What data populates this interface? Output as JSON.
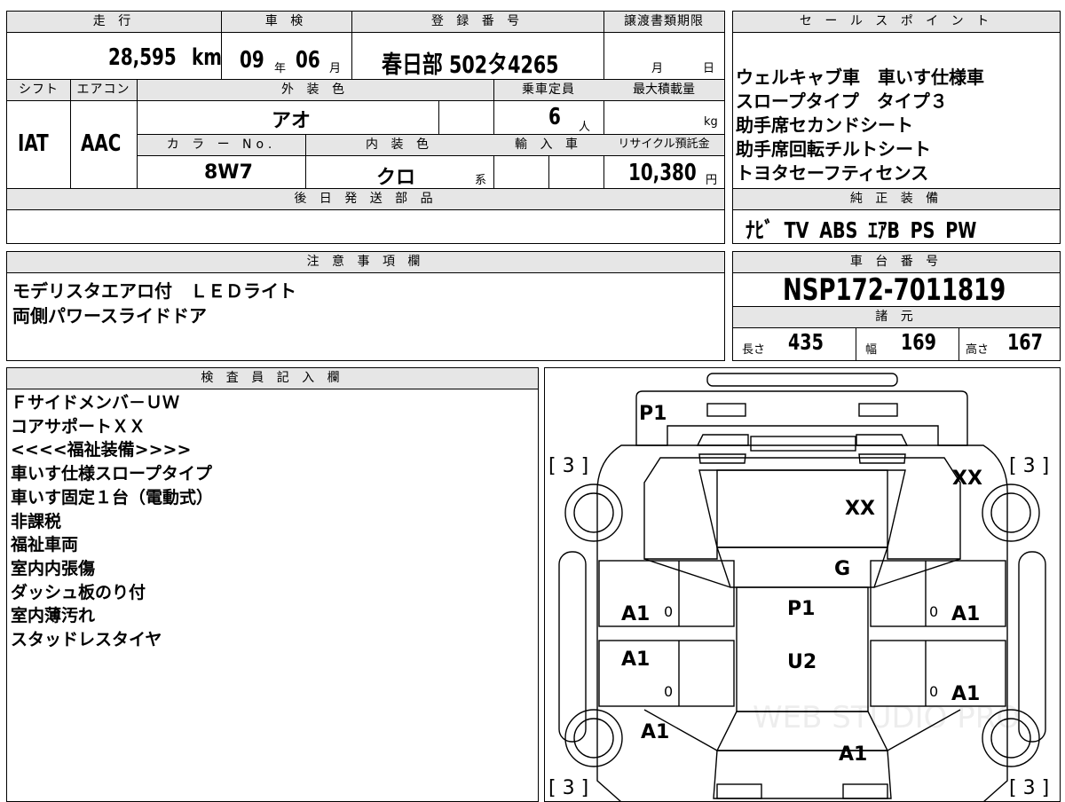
{
  "mileage": {
    "header": "走 行",
    "value": "28,595",
    "unit": "km"
  },
  "inspection": {
    "header": "車 検",
    "year": "09",
    "year_unit": "年",
    "month": "06",
    "month_unit": "月"
  },
  "registration": {
    "header": "登 録 番 号",
    "value": "春日部 502タ4265"
  },
  "transfer_deadline": {
    "header": "譲渡書類期限",
    "month_unit": "月",
    "day_unit": "日"
  },
  "sales_points": {
    "header": "セ ー ル ス ポ イ ン ト",
    "lines": [
      "ウェルキャブ車　車いす仕様車",
      "スロープタイプ　タイプ３",
      "助手席セカンドシート",
      "助手席回転チルトシート",
      "トヨタセーフティセンス"
    ]
  },
  "shift": {
    "header": "シフト",
    "value": "IAT"
  },
  "aircon": {
    "header": "エアコン",
    "value": "AAC"
  },
  "exterior_color": {
    "header": "外 装 色",
    "value": "アオ"
  },
  "capacity": {
    "header": "乗車定員",
    "value": "6",
    "unit": "人"
  },
  "max_load": {
    "header": "最大積載量",
    "unit": "kg"
  },
  "color_no": {
    "header": "カ ラ ー No.",
    "value": "8W7"
  },
  "interior_color": {
    "header": "内 装 色",
    "value": "クロ",
    "suffix": "系"
  },
  "import": {
    "header": "輸 入 車"
  },
  "recycle": {
    "header": "リサイクル預託金",
    "value": "10,380",
    "unit": "円"
  },
  "later_parts": {
    "header": "後 日 発 送 部 品"
  },
  "genuine_equipment": {
    "header": "純 正 装 備",
    "value": "ﾅﾋﾞ TV ABS ｴｱB PS PW"
  },
  "notes": {
    "header": "注 意 事 項 欄",
    "lines": [
      "モデリスタエアロ付　ＬＥＤライト",
      "両側パワースライドドア"
    ]
  },
  "chassis": {
    "header": "車 台 番 号",
    "value": "NSP172-7011819"
  },
  "specs": {
    "header": "諸 元",
    "length_label": "長さ",
    "length": "435",
    "width_label": "幅",
    "width": "169",
    "height_label": "高さ",
    "height": "167"
  },
  "inspector": {
    "header": "検 査 員 記 入 欄",
    "lines": [
      "Ｆサイドメンバ－ＵＷ",
      "コアサポートＸＸ",
      "<<<<福祉装備>>>>",
      "車いす仕様スロープタイプ",
      "車いす固定１台（電動式）",
      "非課税",
      "福祉車両",
      "室内内張傷",
      "ダッシュ板のり付",
      "室内薄汚れ",
      "スタッドレスタイヤ"
    ]
  },
  "diagram": {
    "marks": {
      "front_bumper": "P1",
      "tire_fl": "[ 3 ]",
      "tire_fr": "[ 3 ]",
      "tire_rl": "[ 3 ]",
      "tire_rr": "[ 3 ]",
      "fender_front_right": "XX",
      "hood": "XX",
      "windshield": "G",
      "roof_front": "P1",
      "roof_rear": "U2",
      "door_fl": "A1",
      "door_rl": "A1",
      "door_fr": "A1",
      "door_rr": "A1",
      "quarter_left": "A1",
      "tailgate": "A1",
      "tire_fl_tread": "0",
      "tire_rl_tread": "0",
      "tire_fr_tread": "0",
      "tire_rr_tread": "0"
    },
    "watermark": "WEB STUDIO PRO"
  }
}
